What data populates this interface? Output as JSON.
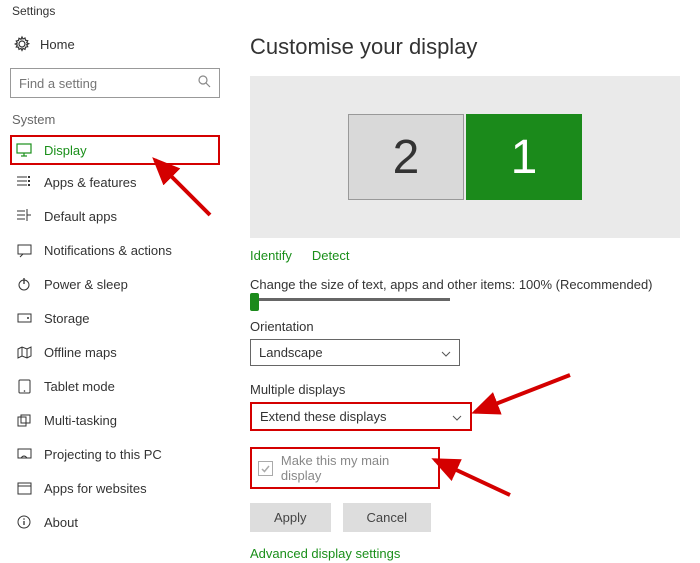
{
  "window_title": "Settings",
  "home_label": "Home",
  "search_placeholder": "Find a setting",
  "section_label": "System",
  "nav": [
    {
      "label": "Display",
      "active": true
    },
    {
      "label": "Apps & features"
    },
    {
      "label": "Default apps"
    },
    {
      "label": "Notifications & actions"
    },
    {
      "label": "Power & sleep"
    },
    {
      "label": "Storage"
    },
    {
      "label": "Offline maps"
    },
    {
      "label": "Tablet mode"
    },
    {
      "label": "Multi-tasking"
    },
    {
      "label": "Projecting to this PC"
    },
    {
      "label": "Apps for websites"
    },
    {
      "label": "About"
    }
  ],
  "page_title": "Customise your display",
  "monitors": {
    "m2": "2",
    "m1": "1"
  },
  "links": {
    "identify": "Identify",
    "detect": "Detect"
  },
  "scale_text": "Change the size of text, apps and other items: 100% (Recommended)",
  "orientation": {
    "label": "Orientation",
    "value": "Landscape"
  },
  "multiple": {
    "label": "Multiple displays",
    "value": "Extend these displays"
  },
  "main_display_checkbox": "Make this my main display",
  "buttons": {
    "apply": "Apply",
    "cancel": "Cancel"
  },
  "advanced_link": "Advanced display settings"
}
